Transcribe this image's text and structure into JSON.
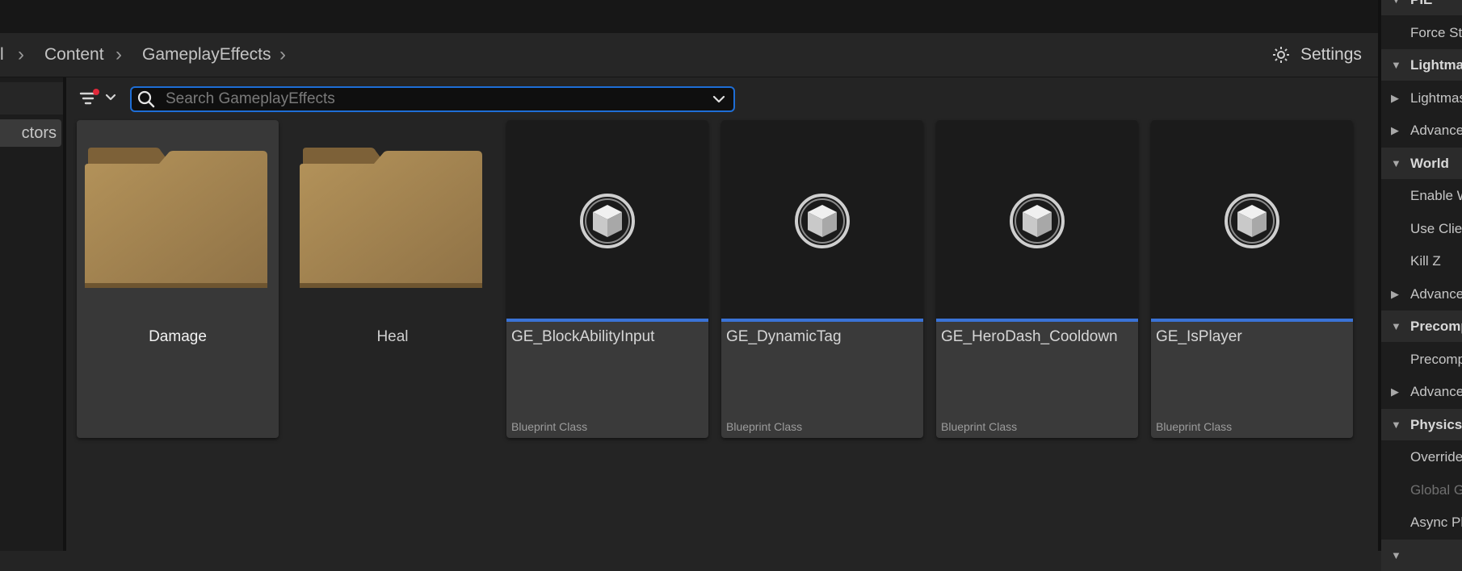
{
  "breadcrumb": {
    "items": [
      "l",
      "Content",
      "GameplayEffects"
    ]
  },
  "settings": {
    "label": "Settings",
    "icon": "gear-icon"
  },
  "left_panel": {
    "item_label": "ctors"
  },
  "search": {
    "placeholder": "Search GameplayEffects",
    "value": ""
  },
  "filter": {
    "icon": "filter-icon",
    "has_indicator": true,
    "indicator_color": "#e0283a"
  },
  "assets": [
    {
      "kind": "folder",
      "name": "Damage",
      "selected": true
    },
    {
      "kind": "folder",
      "name": "Heal",
      "selected": false
    },
    {
      "kind": "blueprint",
      "name": "GE_BlockAbilityInput",
      "type": "Blueprint Class"
    },
    {
      "kind": "blueprint",
      "name": "GE_DynamicTag",
      "type": "Blueprint Class"
    },
    {
      "kind": "blueprint",
      "name": "GE_HeroDash_Cooldown",
      "type": "Blueprint Class"
    },
    {
      "kind": "blueprint",
      "name": "GE_IsPlayer",
      "type": "Blueprint Class"
    }
  ],
  "details": {
    "rows": [
      {
        "kind": "category",
        "label": "PIE",
        "expanded": true
      },
      {
        "kind": "property",
        "label": "Force Sta"
      },
      {
        "kind": "category",
        "label": "Lightmas",
        "expanded": true
      },
      {
        "kind": "group",
        "label": "Lightmas",
        "expanded": false
      },
      {
        "kind": "group",
        "label": "Advanced",
        "expanded": false
      },
      {
        "kind": "category",
        "label": "World",
        "expanded": true
      },
      {
        "kind": "property",
        "label": "Enable W"
      },
      {
        "kind": "property",
        "label": "Use Client"
      },
      {
        "kind": "property",
        "label": "Kill Z"
      },
      {
        "kind": "group",
        "label": "Advanced",
        "expanded": false
      },
      {
        "kind": "category",
        "label": "Precompu",
        "expanded": true
      },
      {
        "kind": "property",
        "label": "Precompu"
      },
      {
        "kind": "group",
        "label": "Advanced",
        "expanded": false
      },
      {
        "kind": "category",
        "label": "Physics",
        "expanded": true
      },
      {
        "kind": "property",
        "label": "Override V"
      },
      {
        "kind": "property",
        "label": "Global Gr",
        "disabled": true
      },
      {
        "kind": "property",
        "label": "Async Phy"
      },
      {
        "kind": "category",
        "label": "",
        "expanded": true
      }
    ]
  },
  "colors": {
    "accent": "#1e6ed6",
    "blueprint_strip": "#3a73d6",
    "folder": "#a88a55"
  }
}
